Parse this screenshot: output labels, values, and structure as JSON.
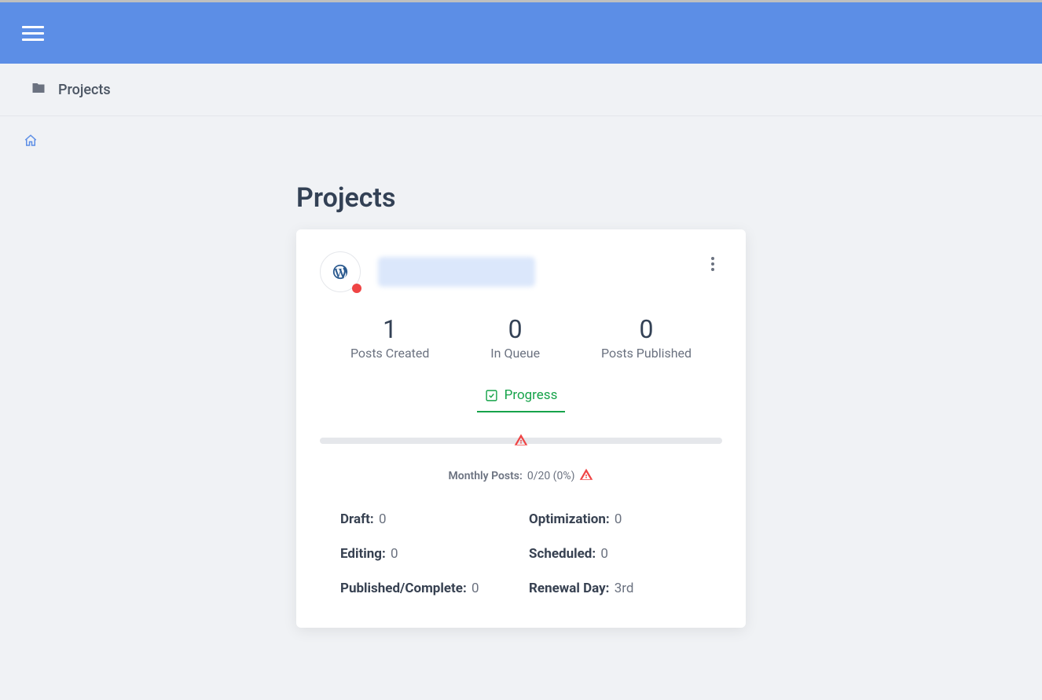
{
  "subbar": {
    "title": "Projects"
  },
  "page": {
    "heading": "Projects"
  },
  "card": {
    "stats": {
      "posts_created": {
        "value": "1",
        "label": "Posts Created"
      },
      "in_queue": {
        "value": "0",
        "label": "In Queue"
      },
      "posts_published": {
        "value": "0",
        "label": "Posts Published"
      }
    },
    "progress_tab": "Progress",
    "monthly": {
      "label": "Monthly Posts:",
      "value": "0/20 (0%)"
    },
    "details": {
      "draft": {
        "label": "Draft:",
        "value": "0"
      },
      "optimization": {
        "label": "Optimization:",
        "value": "0"
      },
      "editing": {
        "label": "Editing:",
        "value": "0"
      },
      "scheduled": {
        "label": "Scheduled:",
        "value": "0"
      },
      "published": {
        "label": "Published/Complete:",
        "value": "0"
      },
      "renewal": {
        "label": "Renewal Day:",
        "value": "3rd"
      }
    }
  }
}
